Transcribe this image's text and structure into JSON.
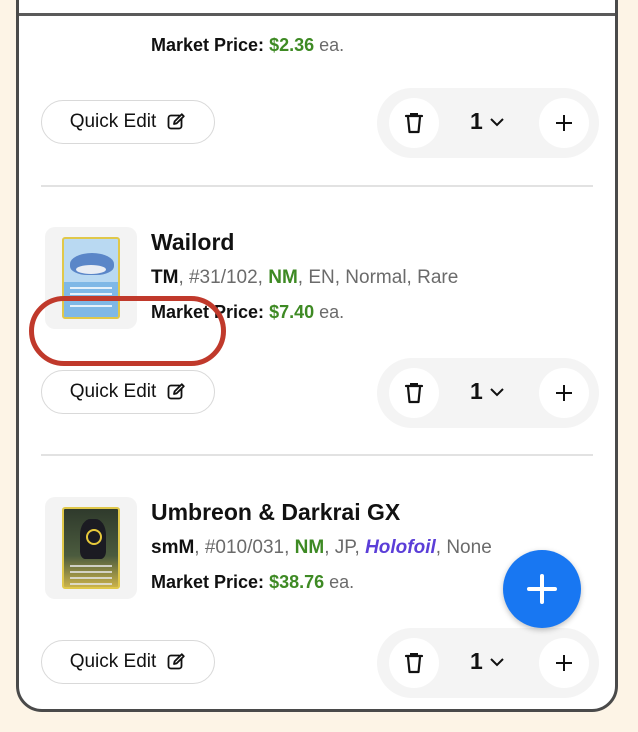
{
  "items": [
    {
      "market_price_label": "Market Price:",
      "market_price": "$2.36",
      "each": "ea.",
      "quick_edit": "Quick Edit",
      "quantity": "1"
    },
    {
      "name": "Wailord",
      "set": "TM",
      "number": ", #31/102, ",
      "condition": "NM",
      "rest": ", EN, Normal, Rare",
      "market_price_label": "Market Price:",
      "market_price": "$7.40",
      "each": "ea.",
      "quick_edit": "Quick Edit",
      "quantity": "1"
    },
    {
      "name": "Umbreon & Darkrai GX",
      "set": "smM",
      "number": ", #010/031, ",
      "condition": "NM",
      "language": ", JP, ",
      "finish": "Holofoil",
      "rest": ", None",
      "market_price_label": "Market Price:",
      "market_price": "$38.76",
      "each": "ea.",
      "quick_edit": "Quick Edit",
      "quantity": "1"
    }
  ],
  "colors": {
    "price_green": "#3e8a24",
    "holofoil_purple": "#5b3ed8",
    "fab_blue": "#1877f2",
    "highlight_red": "#c0392b"
  },
  "icons": [
    "pencil-icon",
    "trash-icon",
    "chevron-down-icon",
    "plus-icon"
  ]
}
